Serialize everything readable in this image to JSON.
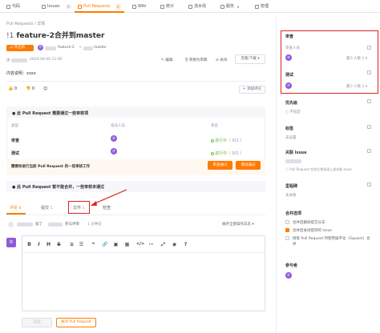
{
  "topnav": {
    "tabs": [
      {
        "label": "代码",
        "badge": ""
      },
      {
        "label": "Issues",
        "badge": "0"
      },
      {
        "label": "Pull Requests",
        "badge": "4"
      },
      {
        "label": "Wiki",
        "badge": ""
      },
      {
        "label": "统计",
        "badge": ""
      },
      {
        "label": "流水线",
        "badge": ""
      },
      {
        "label": "服务",
        "badge": ""
      },
      {
        "label": "管理",
        "badge": ""
      }
    ]
  },
  "breadcrumb": {
    "root": "Pull Requests",
    "sep": "/",
    "current": "详情"
  },
  "pr": {
    "number": "!1",
    "title": "feature-2合并到master",
    "status": "开启的",
    "from_branch": "feature-2",
    "to_branch": "master",
    "created": "2024-06-06 11:00",
    "author_prefix": "由",
    "content_label": "内容说明：",
    "content": "xxxx"
  },
  "header_actions": {
    "edit": "编辑",
    "draft": "转换为草稿",
    "close": "关闭",
    "more": "克隆/下载"
  },
  "reactions": {
    "thumbs_up": "0",
    "thumbs_down": "0",
    "add_label": "+ 添加评论"
  },
  "review": {
    "title": "此 Pull Request 需要通过一些审核项",
    "columns": [
      "类型",
      "指派人员",
      "状态"
    ],
    "rows": [
      {
        "type": "审查",
        "avatar": "许",
        "status": "进行中",
        "progress": "（ 0/1 ）"
      },
      {
        "type": "测试",
        "avatar": "许",
        "status": "进行中",
        "progress": "（ 0/1 ）"
      }
    ],
    "notice": "需要你进行当前 Pull Request 的一些审核工作",
    "btn_review": "审查通过",
    "btn_test": "测试通过"
  },
  "merge_notice": "此 Pull Request 暂不能合并，一些审核未通过",
  "tabs": [
    {
      "label": "评论",
      "count": "0"
    },
    {
      "label": "提交",
      "count": "1"
    },
    {
      "label": "文件",
      "count": "1"
    },
    {
      "label": "检查",
      "count": ""
    }
  ],
  "activity": {
    "text": "加了",
    "role": "参与评审",
    "time": "1 分钟前",
    "expand": "展开全部操作日志"
  },
  "editor": {
    "avatar": "许",
    "toolbar": [
      "B",
      "I",
      "H",
      "S",
      "≡",
      "☰",
      "❝",
      "🔗",
      "▣",
      "▦",
      "</>",
      "⋯",
      "⤢",
      "◉",
      "?"
    ]
  },
  "footer": {
    "comment_btn": "评论",
    "close_btn": "关闭 Pull Request"
  },
  "sidebar": {
    "reviewers_title": "审查",
    "reviewers_sub": "审查人员",
    "reviewers_min": "最少人数",
    "reviewers_min_val": "1",
    "testers_title": "测试",
    "testers_min": "最少人数",
    "testers_min_val": "1",
    "avatar": "许",
    "priority_title": "优先级",
    "priority_value": "不指定",
    "tags_title": "标签",
    "tags_value": "未设置",
    "issue_title": "关联 Issue",
    "issue_hint": "Pull Request 合并后将关闭上述关联 Issue",
    "milestone_title": "里程碑",
    "milestone_value": "未关联",
    "merge_title": "合并选项",
    "merge_opts": [
      {
        "label": "合并后删除提交分支",
        "checked": false
      },
      {
        "label": "合并后关闭提到的 Issue",
        "checked": true
      },
      {
        "label": "接受 Pull Request 时使用扁平化（Squash）合并",
        "checked": false
      }
    ],
    "participants_title": "参与者"
  },
  "colors": {
    "accent": "#ff7a00",
    "annotation": "#e02020",
    "avatar": "#8e5bd6",
    "success": "#67c23a"
  }
}
